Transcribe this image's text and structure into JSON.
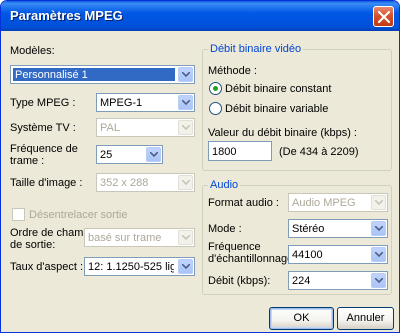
{
  "window": {
    "title": "Paramètres MPEG"
  },
  "left": {
    "modeles_label": "Modèles:",
    "modeles_value": "Personnalisé 1",
    "type_mpeg_label": "Type MPEG :",
    "type_mpeg_value": "MPEG-1",
    "systeme_tv_label": "Système TV :",
    "systeme_tv_value": "PAL",
    "frequence_trame_label_1": "Fréquence de",
    "frequence_trame_label_2": "trame :",
    "frequence_trame_value": "25",
    "taille_image_label": "Taille d'image :",
    "taille_image_value": "352 x 288",
    "desentrelacer_label": "Désentrelacer sortie",
    "ordre_champ_label_1": "Ordre de champ",
    "ordre_champ_label_2": "de sortie:",
    "ordre_champ_value": "basé sur trame",
    "taux_aspect_label": "Taux d'aspect :",
    "taux_aspect_value": "12: 1.1250-525 lign"
  },
  "video": {
    "group_title": "Débit binaire vidéo",
    "methode_label": "Méthode :",
    "radio_constant_label": "Débit binaire constant",
    "radio_variable_label": "Débit binaire variable",
    "valeur_label": "Valeur du débit binaire (kbps) :",
    "valeur_value": "1800",
    "range_text": "(De 434 à 2209)"
  },
  "audio": {
    "group_title": "Audio",
    "format_label": "Format audio :",
    "format_value": "Audio MPEG",
    "mode_label": "Mode :",
    "mode_value": "Stéréo",
    "frequence_label_1": "Fréquence",
    "frequence_label_2": "d'échantillonnage :",
    "frequence_value": "44100",
    "debit_label": "Débit (kbps):",
    "debit_value": "224"
  },
  "buttons": {
    "ok_label": "OK",
    "cancel_label": "Annuler"
  },
  "colors": {
    "title_bar": "#0058e6",
    "selection": "#316ac5",
    "group_title": "#0046d5",
    "radio_dot": "#21a121"
  },
  "icons": {
    "close": "close-x-icon",
    "dropdown": "chevron-down-icon"
  }
}
